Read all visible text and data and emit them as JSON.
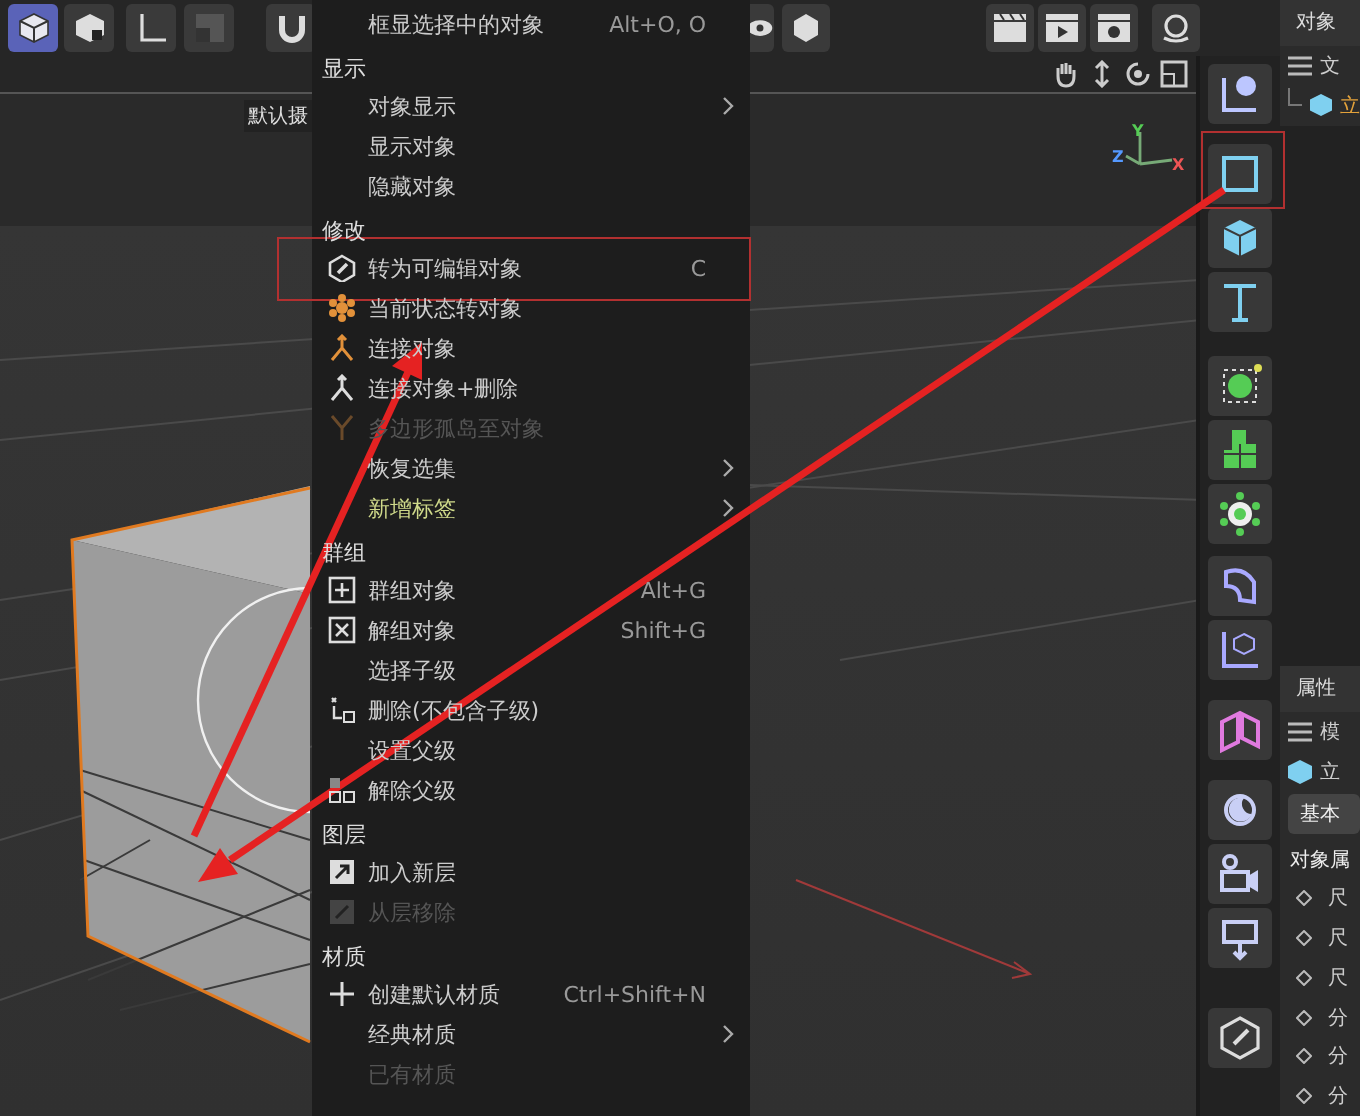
{
  "top_toolbar": {
    "tools": [
      {
        "selected": true
      },
      {
        "selected": false
      },
      {
        "selected": false
      },
      {
        "selected": false
      },
      {
        "selected": false
      }
    ]
  },
  "viewport": {
    "camera_label": "默认摄",
    "axis_labels": [
      "Y",
      "Z",
      "X"
    ]
  },
  "context_menu": {
    "sections": [
      {
        "items": [
          {
            "label": "框显选择中的对象",
            "shortcut": "Alt+O, O",
            "submenu": false,
            "disabled": false,
            "emphasized": false
          }
        ]
      },
      {
        "heading": "显示",
        "items": [
          {
            "label": "对象显示",
            "submenu": true,
            "disabled": false,
            "emphasized": false
          },
          {
            "label": "显示对象",
            "submenu": false,
            "disabled": false,
            "emphasized": false
          },
          {
            "label": "隐藏对象",
            "submenu": false,
            "disabled": false,
            "emphasized": false
          }
        ]
      },
      {
        "heading": "修改",
        "items": [
          {
            "label": "转为可编辑对象",
            "shortcut": "C",
            "submenu": false,
            "disabled": false,
            "emphasized": false
          },
          {
            "label": "当前状态转对象",
            "submenu": false,
            "disabled": false,
            "emphasized": false
          },
          {
            "label": "连接对象",
            "submenu": false,
            "disabled": false,
            "emphasized": false
          },
          {
            "label": "连接对象+删除",
            "submenu": false,
            "disabled": false,
            "emphasized": false
          },
          {
            "label": "多边形孤岛至对象",
            "submenu": false,
            "disabled": true,
            "emphasized": false
          },
          {
            "label": "恢复选集",
            "submenu": true,
            "disabled": false,
            "emphasized": false
          },
          {
            "label": "新增标签",
            "submenu": true,
            "disabled": false,
            "emphasized": true
          }
        ]
      },
      {
        "heading": "群组",
        "items": [
          {
            "label": "群组对象",
            "shortcut": "Alt+G",
            "submenu": false,
            "disabled": false,
            "emphasized": false
          },
          {
            "label": "解组对象",
            "shortcut": "Shift+G",
            "submenu": false,
            "disabled": false,
            "emphasized": false
          },
          {
            "label": "选择子级",
            "submenu": false,
            "disabled": false,
            "emphasized": false
          },
          {
            "label": "删除(不包含子级)",
            "submenu": false,
            "disabled": false,
            "emphasized": false
          },
          {
            "label": "设置父级",
            "submenu": false,
            "disabled": false,
            "emphasized": false
          },
          {
            "label": "解除父级",
            "submenu": false,
            "disabled": false,
            "emphasized": false
          }
        ]
      },
      {
        "heading": "图层",
        "items": [
          {
            "label": "加入新层",
            "submenu": false,
            "disabled": false,
            "emphasized": false
          },
          {
            "label": "从层移除",
            "submenu": false,
            "disabled": true,
            "emphasized": false
          }
        ]
      },
      {
        "heading": "材质",
        "items": [
          {
            "label": "创建默认材质",
            "shortcut": "Ctrl+Shift+N",
            "submenu": false,
            "disabled": false,
            "emphasized": false
          },
          {
            "label": "经典材质",
            "submenu": true,
            "disabled": false,
            "emphasized": false
          },
          {
            "label": "已有材质",
            "submenu": false,
            "disabled": true,
            "emphasized": false
          }
        ]
      }
    ]
  },
  "object_manager": {
    "tab": "对象",
    "menu_label": "文",
    "objects": [
      {
        "name": "立",
        "selected": true
      }
    ]
  },
  "attribute_manager": {
    "tab": "属性",
    "mode_label": "模",
    "object_name": "立",
    "tabs": [
      {
        "label": "基本",
        "selected": true
      }
    ],
    "group_title": "对象属",
    "fields": [
      "尺",
      "尺",
      "尺",
      "分",
      "分",
      "分"
    ]
  }
}
